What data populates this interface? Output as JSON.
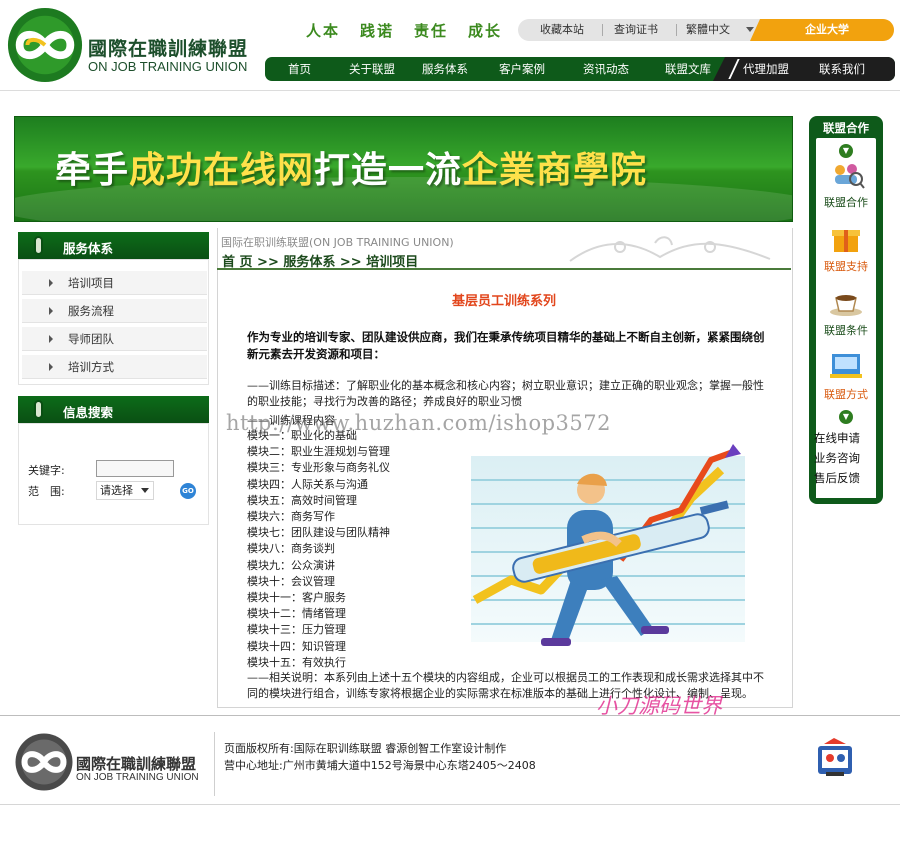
{
  "header": {
    "logo_cn": "國際在職訓練聯盟",
    "logo_en": "ON JOB TRAINING UNION",
    "slogans": [
      "人本",
      "践诺",
      "责任",
      "成长"
    ],
    "toplinks": [
      "收藏本站",
      "查询证书",
      "繁體中文"
    ],
    "university_button": "企业大学",
    "nav": [
      "首页",
      "关于联盟",
      "服务体系",
      "客户案例",
      "资讯动态",
      "联盟文库",
      "代理加盟",
      "联系我们"
    ]
  },
  "banner": {
    "part1": "牵手",
    "part2": "成功在线网",
    "part3": "打造一流",
    "part4": "企業商學院"
  },
  "sidebar_right": {
    "title": "联盟合作",
    "items": [
      "联盟合作",
      "联盟支持",
      "联盟条件",
      "联盟方式"
    ],
    "links": [
      "在线申请",
      "业务咨询",
      "售后反馈"
    ]
  },
  "service_box": {
    "title": "服务体系",
    "items": [
      "培训项目",
      "服务流程",
      "导师团队",
      "培训方式"
    ]
  },
  "search_box": {
    "title": "信息搜索",
    "keyword_label": "关键字:",
    "range_label": "范　围:",
    "select_value": "请选择",
    "go_label": "GO"
  },
  "content": {
    "org": "国际在职训练联盟(ON JOB TRAINING UNION)",
    "breadcrumb": "首 页 >> 服务体系 >> 培训项目",
    "title": "基层员工训练系列",
    "intro": "作为专业的培训专家、团队建设供应商，我们在秉承传统项目精华的基础上不断自主创新，紧紧围绕创新元素去开发资源和项目：",
    "goal": "——训练目标描述：了解职业化的基本概念和核心内容；树立职业意识；建立正确的职业观念；掌握一般性的职业技能；寻找行为改善的路径；养成良好的职业习惯",
    "course_label": "——训练课程内容",
    "modules": [
      "模块一：职业化的基础",
      "模块二：职业生涯规划与管理",
      "模块三：专业形象与商务礼仪",
      "模块四：人际关系与沟通",
      "模块五：高效时间管理",
      "模块六：商务写作",
      "模块七：团队建设与团队精神",
      "模块八：商务谈判",
      "模块九：公众演讲",
      "模块十：会议管理",
      "模块十一：客户服务",
      "模块十二：情绪管理",
      "模块十三：压力管理",
      "模块十四：知识管理",
      "模块十五：有效执行"
    ],
    "note": "——相关说明：本系列由上述十五个模块的内容组成，企业可以根据员工的工作表现和成长需求选择其中不同的模块进行组合，训练专家将根据企业的实际需求在标准版本的基础上进行个性化设计、编制、呈现。"
  },
  "watermarks": {
    "url": "http://www.huzhan.com/ishop3572",
    "brand": "小刀源码世界"
  },
  "footer": {
    "logo_cn": "國際在職訓練聯盟",
    "logo_en": "ON JOB TRAINING UNION",
    "copyright": "页面版权所有:国际在职训练联盟 睿源创智工作室设计制作",
    "address": "营中心地址:广州市黄埔大道中152号海景中心东塔2405～2408"
  },
  "colors": {
    "brand_green": "#0e5a1a",
    "banner_green": "#39a92c",
    "accent_orange": "#f2a20e",
    "title_red": "#e2461c",
    "banner_yellow": "#ffe14a"
  },
  "icons": {
    "logo": "green-circle-infinity-logo",
    "coop": "magnifier-people-icon",
    "support": "gift-box-icon",
    "conditions": "coffee-cup-icon",
    "method": "computer-box-icon",
    "footer_badge": "cartoon-badge-icon"
  }
}
